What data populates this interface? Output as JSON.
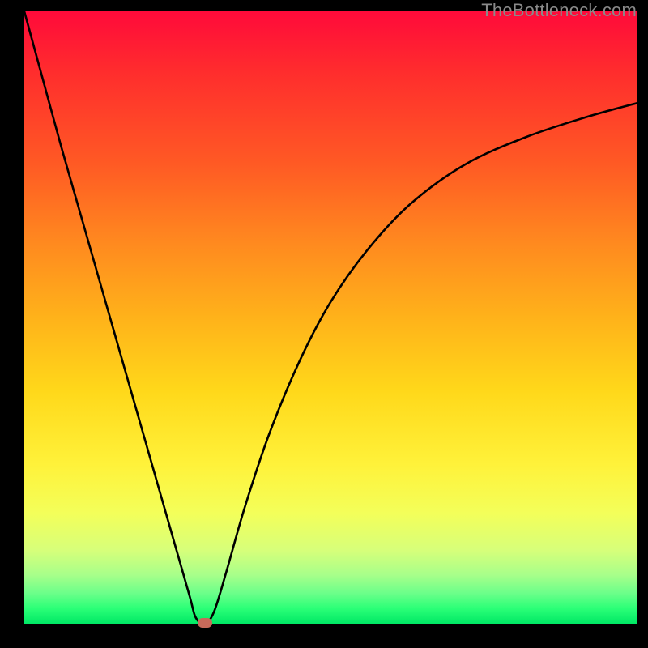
{
  "watermark": "TheBottleneck.com",
  "chart_data": {
    "type": "line",
    "title": "",
    "xlabel": "",
    "ylabel": "",
    "xlim": [
      0,
      100
    ],
    "ylim": [
      0,
      100
    ],
    "series": [
      {
        "name": "curve",
        "x": [
          0.0,
          3.0,
          6.0,
          9.0,
          12.0,
          15.0,
          18.0,
          21.0,
          24.0,
          27.0,
          28.0,
          29.5,
          31.0,
          33.0,
          36.0,
          40.0,
          45.0,
          50.0,
          56.0,
          63.0,
          72.0,
          82.0,
          92.0,
          100.0
        ],
        "values": [
          100.0,
          89.0,
          78.0,
          67.5,
          57.0,
          46.5,
          36.0,
          25.5,
          15.0,
          4.5,
          1.0,
          0.0,
          2.0,
          8.5,
          19.0,
          31.0,
          43.0,
          52.5,
          61.0,
          68.5,
          75.0,
          79.5,
          82.8,
          85.0
        ]
      }
    ],
    "marker": {
      "x": 29.5,
      "y": 0.0
    },
    "background": {
      "type": "vertical-gradient",
      "stops": [
        {
          "pos": 0.0,
          "color": "#ff0a3a"
        },
        {
          "pos": 0.25,
          "color": "#ff5a24"
        },
        {
          "pos": 0.5,
          "color": "#ffb21a"
        },
        {
          "pos": 0.74,
          "color": "#fff23a"
        },
        {
          "pos": 0.92,
          "color": "#a8ff8a"
        },
        {
          "pos": 1.0,
          "color": "#00e865"
        }
      ]
    }
  }
}
